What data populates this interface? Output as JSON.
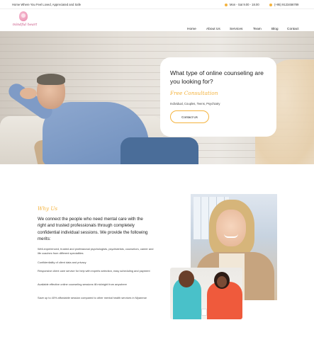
{
  "topbar": {
    "tagline": "Home Where You Feel Loved, Appreciated and Safe",
    "hours": "Mon - Sat 9.00 - 18.00",
    "phone": "(+95) 9123456789",
    "hours_icon": "clock-icon",
    "phone_icon": "phone-icon",
    "accent": "#f4b33e"
  },
  "header": {
    "logo_text": "mindful heart",
    "nav": [
      "Home",
      "About Us",
      "Services",
      "Team",
      "Blog",
      "Contact"
    ]
  },
  "hero": {
    "question": "What type of online counseling are you looking for?",
    "free": "Free Consultation",
    "types": "Individual, Couples, Teens, Psychiatry",
    "button": "Contact Us"
  },
  "why": {
    "heading": "Why Us",
    "lead": "We connect the people who need mental care with the right and trusted professionals through completely confidential individual sessions. We provide the following merits:",
    "merits": [
      "Well-experienced, trusted and professional psychologists, psychiatrists, counselors, career and life coaches from different specialities",
      "Confidentiality of client data and privacy",
      "Responsive client care service for help with experts selection, easy scheduling and payment",
      "Available effective online counseling sessions till midnight from anywhere",
      "Save up to 40% affordable session compared to other mental health services in Myanmar"
    ]
  }
}
